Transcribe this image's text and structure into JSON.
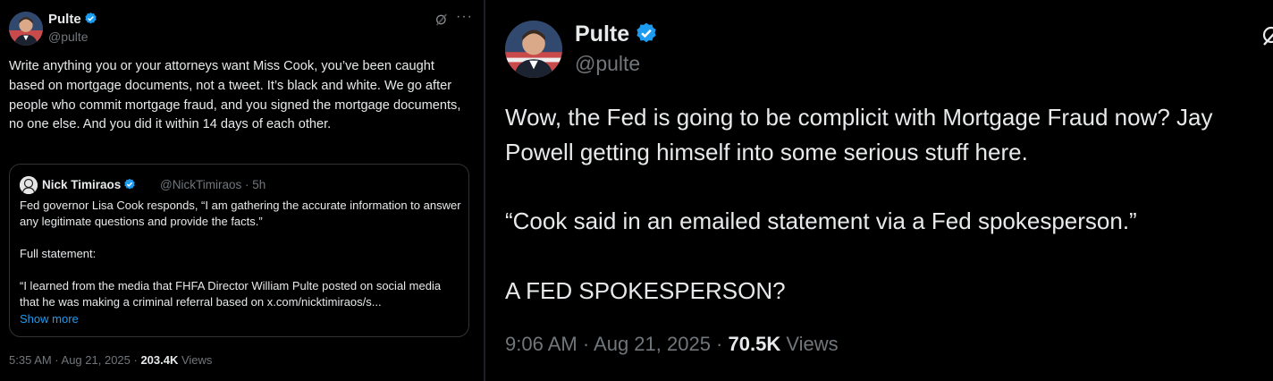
{
  "colors": {
    "background": "#000000",
    "text": "#e7e9ea",
    "muted": "#71767b",
    "link": "#1d9bf0",
    "verified": "#1d9bf0"
  },
  "left_tweet": {
    "author": {
      "name": "Pulte",
      "handle": "@pulte",
      "verified_icon": "verified-badge-icon"
    },
    "grok_icon": "grok-icon",
    "more": "···",
    "text": "Write anything you or your attorneys want Miss Cook, you’ve been caught based on mortgage documents, not a tweet. It’s black and white. We go after people who commit mortgage fraud, and you signed the mortgage documents, no one else. And you did it within 14 days of each other.",
    "quote": {
      "author": {
        "name": "Nick Timiraos",
        "meta": "@NickTimiraos · 5h"
      },
      "text_1": "Fed governor Lisa Cook responds, “I am gathering the accurate information to answer any legitimate questions and provide the facts.”",
      "text_2": "Full statement:",
      "text_3": "“I learned from the media that FHFA Director William Pulte posted on social media that he was making a criminal referral based on x.com/nicktimiraos/s...",
      "show_more": "Show more"
    },
    "footer": {
      "time": "5:35 AM · Aug 21, 2025 · ",
      "views_count": "203.4K",
      "views_label": " Views"
    }
  },
  "right_tweet": {
    "author": {
      "name": "Pulte",
      "handle": "@pulte",
      "verified_icon": "verified-badge-icon"
    },
    "grok_icon": "grok-icon",
    "text_1": "Wow, the Fed is going to be complicit with Mortgage Fraud now? Jay Powell getting himself into some serious stuff here.",
    "text_2": "“Cook said in an emailed statement via a Fed spokesperson.”",
    "text_3": "A FED SPOKESPERSON?",
    "footer": {
      "time": "9:06 AM · Aug 21, 2025 · ",
      "views_count": "70.5K",
      "views_label": " Views"
    }
  }
}
